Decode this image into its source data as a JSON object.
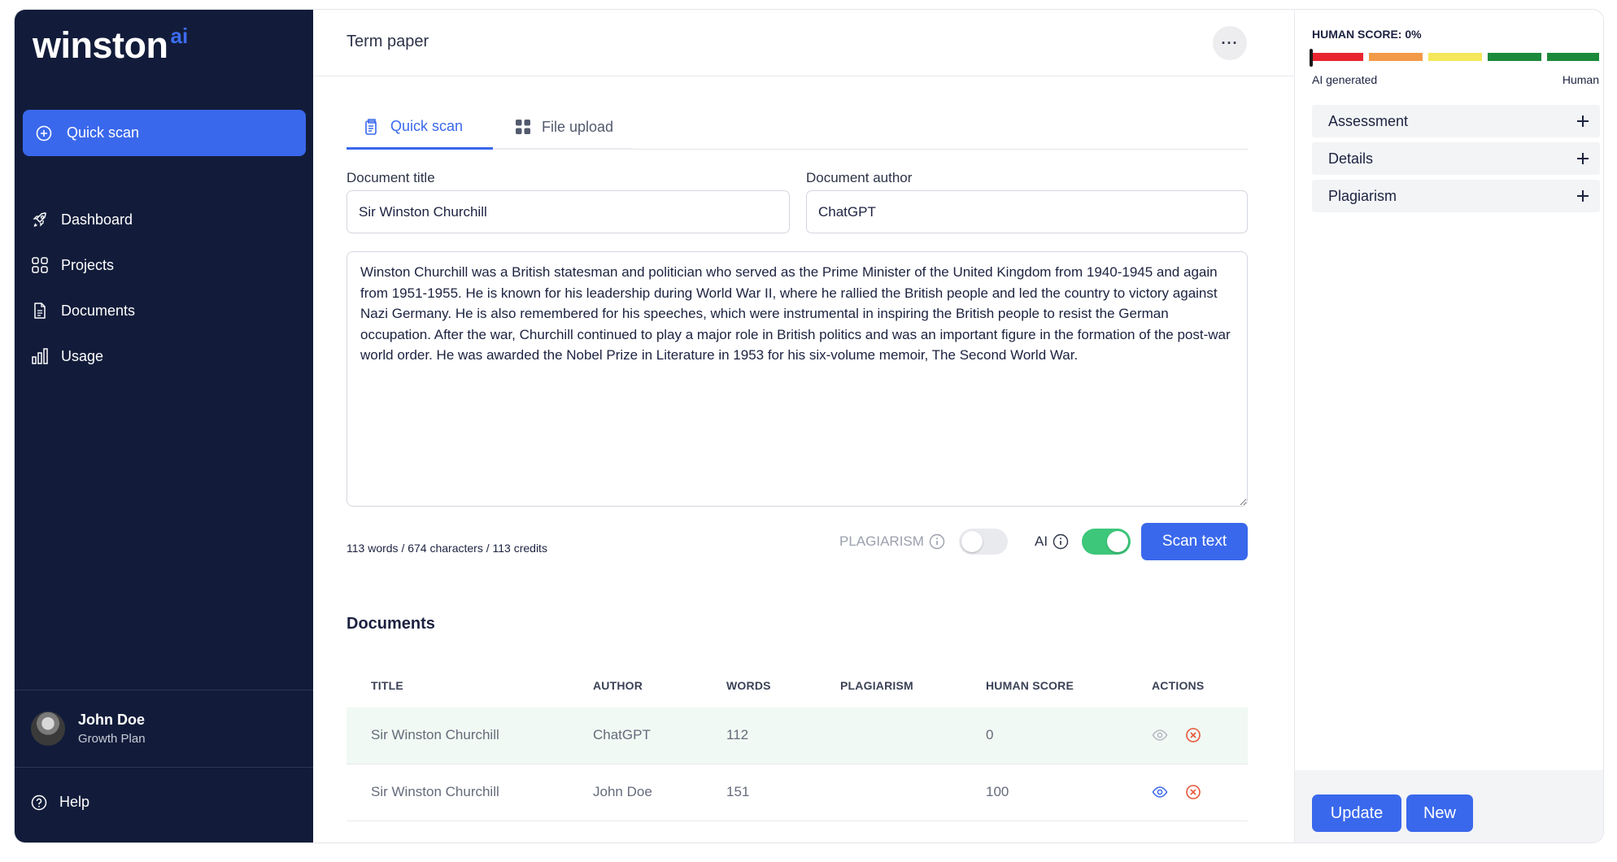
{
  "brand": {
    "name": "winston",
    "suffix": "ai"
  },
  "sidebar": {
    "quick_scan_label": "Quick scan",
    "items": [
      {
        "label": "Dashboard",
        "icon": "rocket-icon"
      },
      {
        "label": "Projects",
        "icon": "grid-icon"
      },
      {
        "label": "Documents",
        "icon": "document-icon"
      },
      {
        "label": "Usage",
        "icon": "bar-chart-icon"
      }
    ],
    "user": {
      "name": "John Doe",
      "plan": "Growth Plan"
    },
    "help_label": "Help"
  },
  "header": {
    "title": "Term paper",
    "more_icon": "ellipsis-icon"
  },
  "tabs": [
    {
      "label": "Quick scan",
      "active": true,
      "icon": "clipboard-icon"
    },
    {
      "label": "File upload",
      "active": false,
      "icon": "grid-icon"
    }
  ],
  "form": {
    "title_label": "Document title",
    "title_value": "Sir Winston Churchill",
    "author_label": "Document author",
    "author_value": "ChatGPT",
    "content": "Winston Churchill was a British statesman and politician who served as the Prime Minister of the United Kingdom from 1940-1945 and again from 1951-1955. He is known for his leadership during World War II, where he rallied the British people and led the country to victory against Nazi Germany. He is also remembered for his speeches, which were instrumental in inspiring the British people to resist the German occupation. After the war, Churchill continued to play a major role in British politics and was an important figure in the formation of the post-war world order. He was awarded the Nobel Prize in Literature in 1953 for his six-volume memoir, The Second World War.",
    "stats": "113 words / 674 characters / 113 credits",
    "plagiarism_label": "PLAGIARISM",
    "plagiarism_on": false,
    "ai_label": "AI",
    "ai_on": true,
    "scan_label": "Scan text"
  },
  "documents": {
    "heading": "Documents",
    "columns": [
      "TITLE",
      "AUTHOR",
      "WORDS",
      "PLAGIARISM",
      "HUMAN SCORE",
      "ACTIONS"
    ],
    "rows": [
      {
        "title": "Sir Winston Churchill",
        "author": "ChatGPT",
        "words": "112",
        "plagiarism": "",
        "human_score": "0"
      },
      {
        "title": "Sir Winston Churchill",
        "author": "John Doe",
        "words": "151",
        "plagiarism": "",
        "human_score": "100"
      }
    ]
  },
  "score_panel": {
    "label": "HUMAN SCORE: 0%",
    "value_percent": 0,
    "left_label": "AI generated",
    "right_label": "Human",
    "segment_colors": [
      "#e8252f",
      "#f39a48",
      "#f5e75a",
      "#1c8a3a",
      "#1c8a3a"
    ],
    "accordion": [
      "Assessment",
      "Details",
      "Plagiarism"
    ],
    "update_label": "Update",
    "new_label": "New"
  },
  "colors": {
    "sidebar_bg": "#121c3a",
    "accent": "#3a68ec",
    "toggle_on": "#3cc77a",
    "delete_icon": "#e8563a"
  }
}
